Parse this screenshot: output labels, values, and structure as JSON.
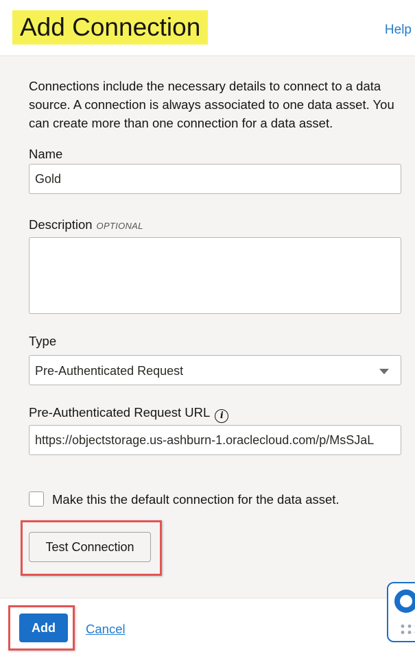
{
  "panel": {
    "title": "Add Connection",
    "help_link": "Help"
  },
  "form": {
    "intro": "Connections include the necessary details to connect to a data source. A connection is always associated to one data asset. You can create more than one connection for a data asset.",
    "name_label": "Name",
    "name_value": "Gold",
    "description_label": "Description",
    "description_optional": "OPTIONAL",
    "description_value": "",
    "type_label": "Type",
    "type_value": "Pre-Authenticated Request",
    "url_label": "Pre-Authenticated Request URL",
    "url_value": "https://objectstorage.us-ashburn-1.oraclecloud.com/p/MsSJaL",
    "default_checkbox_label": "Make this the default connection for the data asset.",
    "default_checked": false,
    "test_button": "Test Connection"
  },
  "footer": {
    "add_button": "Add",
    "cancel_link": "Cancel"
  },
  "icons": {
    "info": "info-circle-icon",
    "caret": "caret-down-icon",
    "help_widget": "lifebuoy-icon"
  },
  "colors": {
    "title_highlight": "#f6f256",
    "link": "#227ccc",
    "primary_button": "#1a6fc9",
    "annotation_box": "#e25454",
    "content_background": "#f5f4f2"
  }
}
